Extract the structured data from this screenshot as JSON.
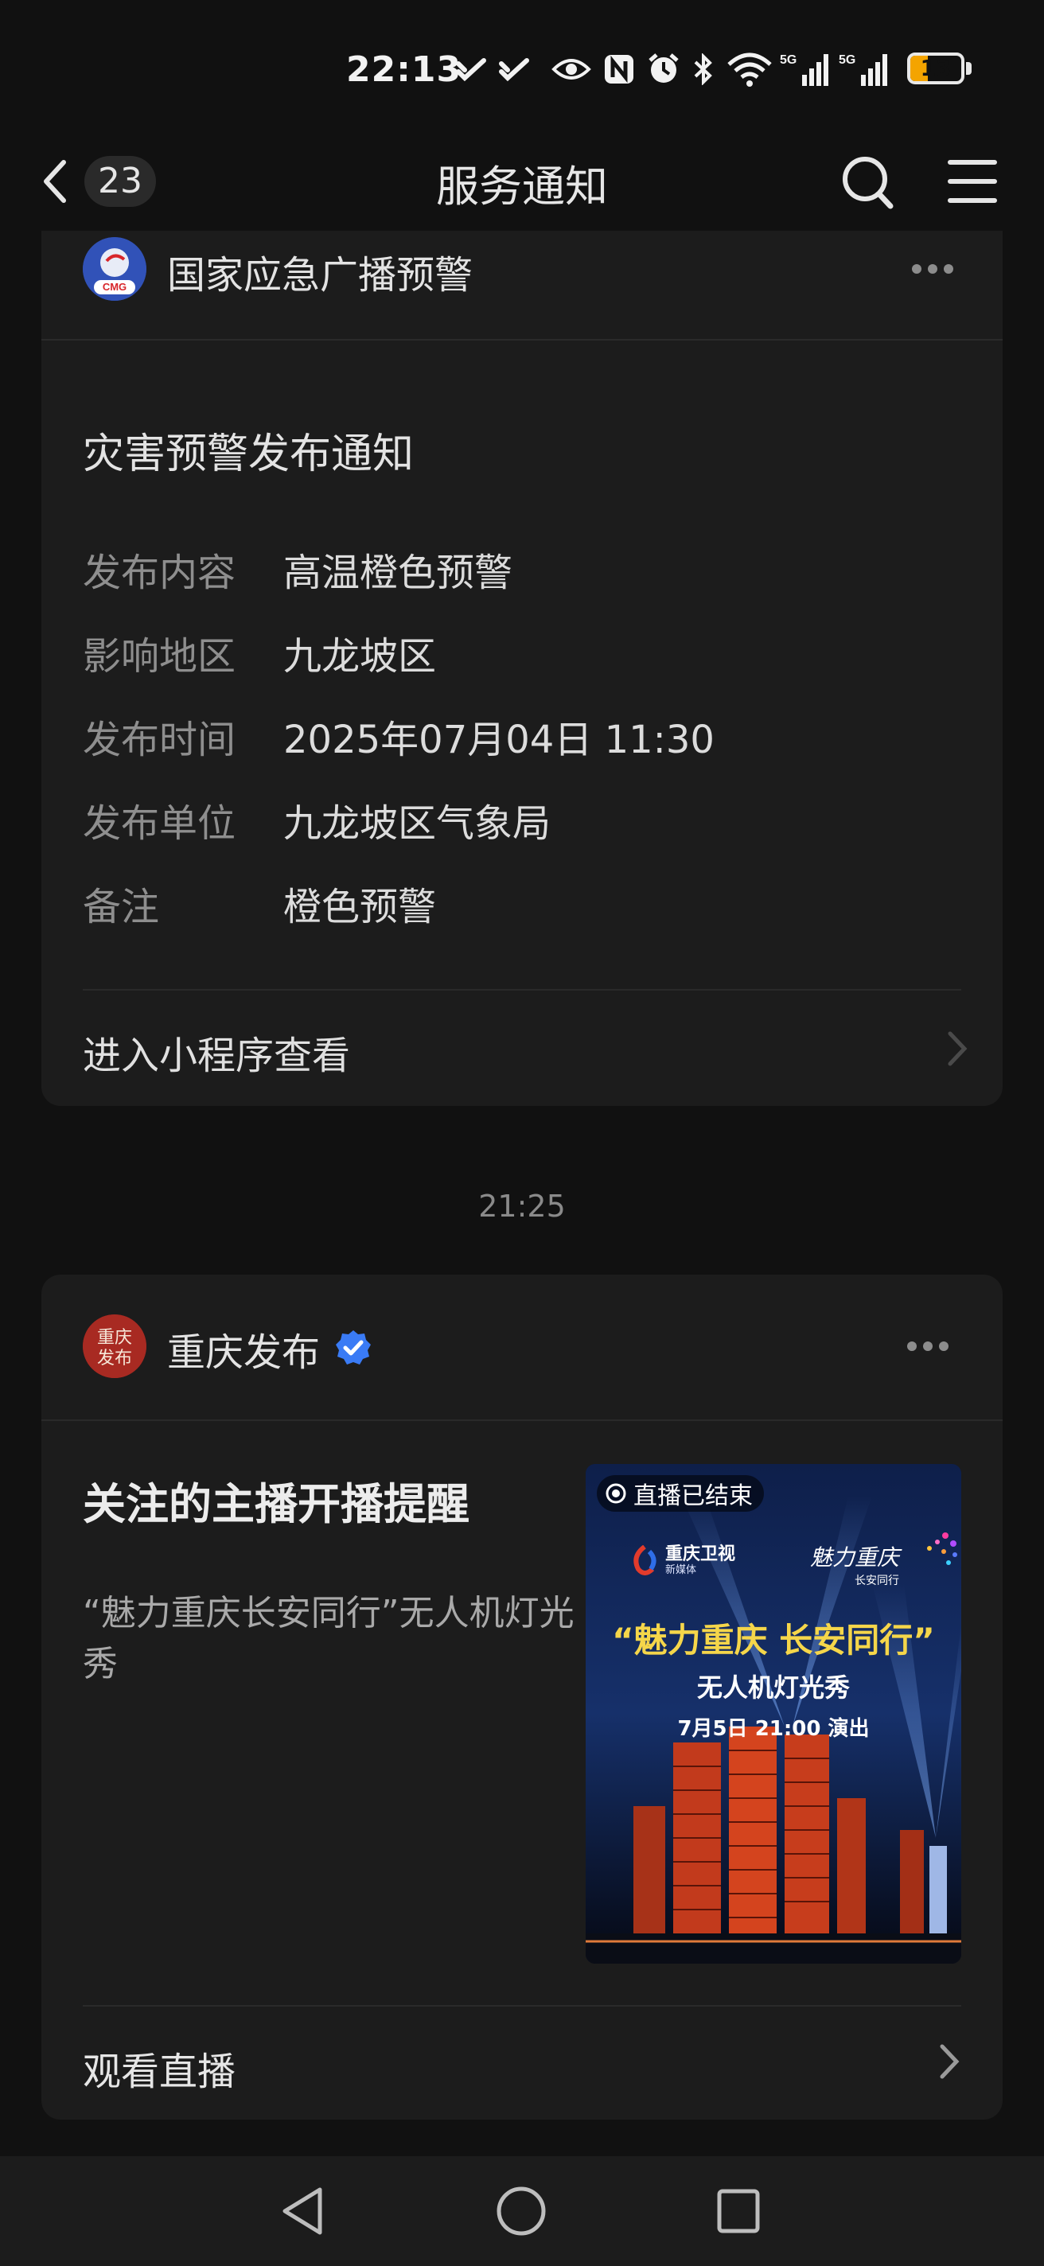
{
  "status_bar": {
    "time": "22:13",
    "battery": "13",
    "battery_color": "#f4a400",
    "signal_label": "5G",
    "icons": [
      "pay-icon",
      "pay-icon-2",
      "eye-icon",
      "nfc-icon",
      "alarm-icon",
      "bluetooth-icon",
      "wifi-icon",
      "signal-icon",
      "signal-icon-2",
      "battery-icon"
    ]
  },
  "nav": {
    "back_count": "23",
    "title": "服务通知",
    "icons": [
      "back-chevron-icon",
      "search-icon",
      "menu-icon"
    ]
  },
  "card1": {
    "account_name": "国家应急广播预警",
    "avatar_text": "CMG",
    "title": "灾害预警发布通知",
    "rows": [
      {
        "label": "发布内容",
        "value": "高温橙色预警"
      },
      {
        "label": "影响地区",
        "value": "九龙坡区"
      },
      {
        "label": "发布时间",
        "value": "2025年07月04日 11:30"
      },
      {
        "label": "发布单位",
        "value": "九龙坡区气象局"
      },
      {
        "label": "备注",
        "value": "橙色预警"
      }
    ],
    "action_label": "进入小程序查看"
  },
  "timestamp": "21:25",
  "card2": {
    "account_name": "重庆发布",
    "verified": true,
    "title": "关注的主播开播提醒",
    "description": "“魅力重庆长安同行”无人机灯光秀",
    "thumbnail": {
      "live_status": "直播已结束",
      "channel_name": "重庆卫视",
      "channel_sub": "新媒体",
      "brand_logo_text": "魅力重庆",
      "brand_logo_sub": "长安同行",
      "headline": "“魅力重庆 长安同行”",
      "subheadline": "无人机灯光秀",
      "schedule": "7月5日 21:00 演出"
    },
    "action_label": "观看直播"
  },
  "bottom_nav": {
    "icons": [
      "back-triangle-icon",
      "home-circle-icon",
      "recents-square-icon"
    ]
  }
}
